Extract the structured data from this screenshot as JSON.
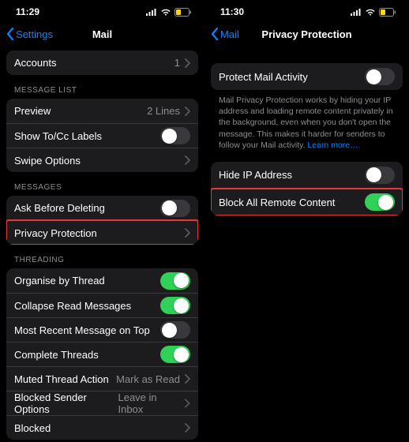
{
  "left": {
    "status": {
      "time": "11:29"
    },
    "nav": {
      "back": "Settings",
      "title": "Mail"
    },
    "top_group": [
      {
        "label": "Accounts",
        "value": "1"
      }
    ],
    "sections": {
      "message_list": {
        "header": "MESSAGE LIST",
        "rows": {
          "preview": {
            "label": "Preview",
            "value": "2 Lines"
          },
          "showtocc": {
            "label": "Show To/Cc Labels"
          },
          "swipe": {
            "label": "Swipe Options"
          }
        }
      },
      "messages": {
        "header": "MESSAGES",
        "rows": {
          "askdel": {
            "label": "Ask Before Deleting"
          },
          "privacy": {
            "label": "Privacy Protection"
          }
        }
      },
      "threading": {
        "header": "THREADING",
        "rows": {
          "organise": {
            "label": "Organise by Thread"
          },
          "collapse": {
            "label": "Collapse Read Messages"
          },
          "recent": {
            "label": "Most Recent Message on Top"
          },
          "complete": {
            "label": "Complete Threads"
          },
          "muted": {
            "label": "Muted Thread Action",
            "value": "Mark as Read"
          },
          "blockedopt": {
            "label": "Blocked Sender Options",
            "value": "Leave in Inbox"
          },
          "blocked": {
            "label": "Blocked"
          }
        }
      }
    }
  },
  "right": {
    "status": {
      "time": "11:30"
    },
    "nav": {
      "back": "Mail",
      "title": "Privacy Protection"
    },
    "group1": {
      "protect": {
        "label": "Protect Mail Activity"
      },
      "footer": "Mail Privacy Protection works by hiding your IP address and loading remote content privately in the background, even when you don't open the message. This makes it harder for senders to follow your Mail activity. ",
      "learn": "Learn more…"
    },
    "group2": {
      "hideip": {
        "label": "Hide IP Address"
      },
      "block": {
        "label": "Block All Remote Content"
      }
    }
  }
}
